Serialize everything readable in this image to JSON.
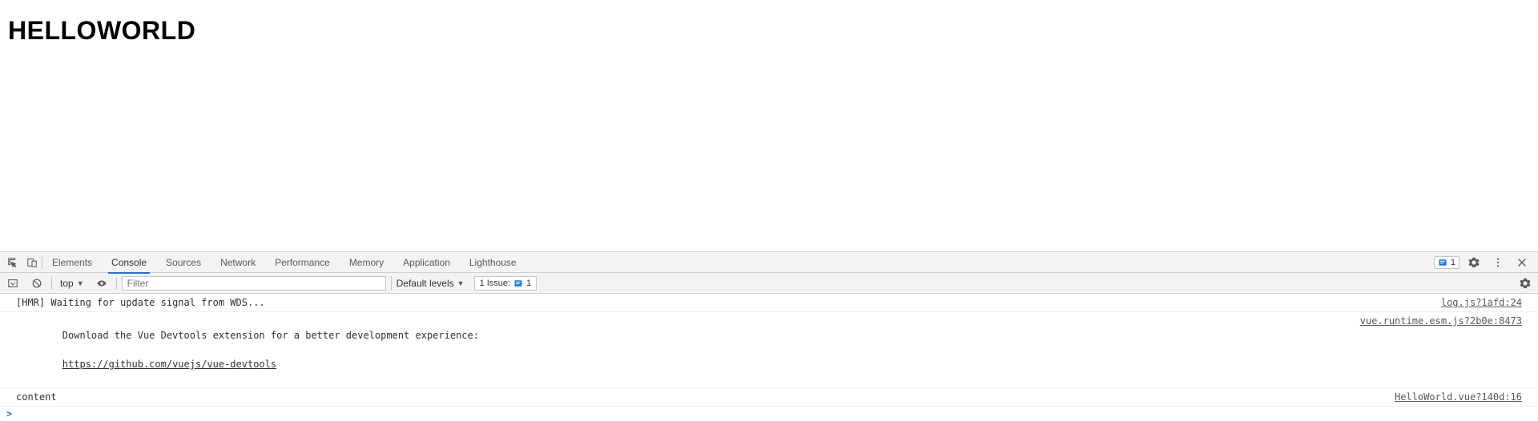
{
  "page": {
    "heading": "HELLOWORLD"
  },
  "devtools": {
    "tabs": {
      "elements": "Elements",
      "console": "Console",
      "sources": "Sources",
      "network": "Network",
      "performance": "Performance",
      "memory": "Memory",
      "application": "Application",
      "lighthouse": "Lighthouse"
    },
    "topIssueCount": "1",
    "filterBar": {
      "context": "top",
      "filterPlaceholder": "Filter",
      "levels": "Default levels",
      "issuesLabel": "1 Issue:",
      "issuesCount": "1"
    },
    "logs": [
      {
        "message": "[HMR] Waiting for update signal from WDS...",
        "source": "log.js?1afd:24"
      },
      {
        "message": "Download the Vue Devtools extension for a better development experience:",
        "link": "https://github.com/vuejs/vue-devtools",
        "source": "vue.runtime.esm.js?2b0e:8473"
      },
      {
        "message": "content",
        "source": "HelloWorld.vue?140d:16"
      }
    ],
    "prompt": ">"
  }
}
